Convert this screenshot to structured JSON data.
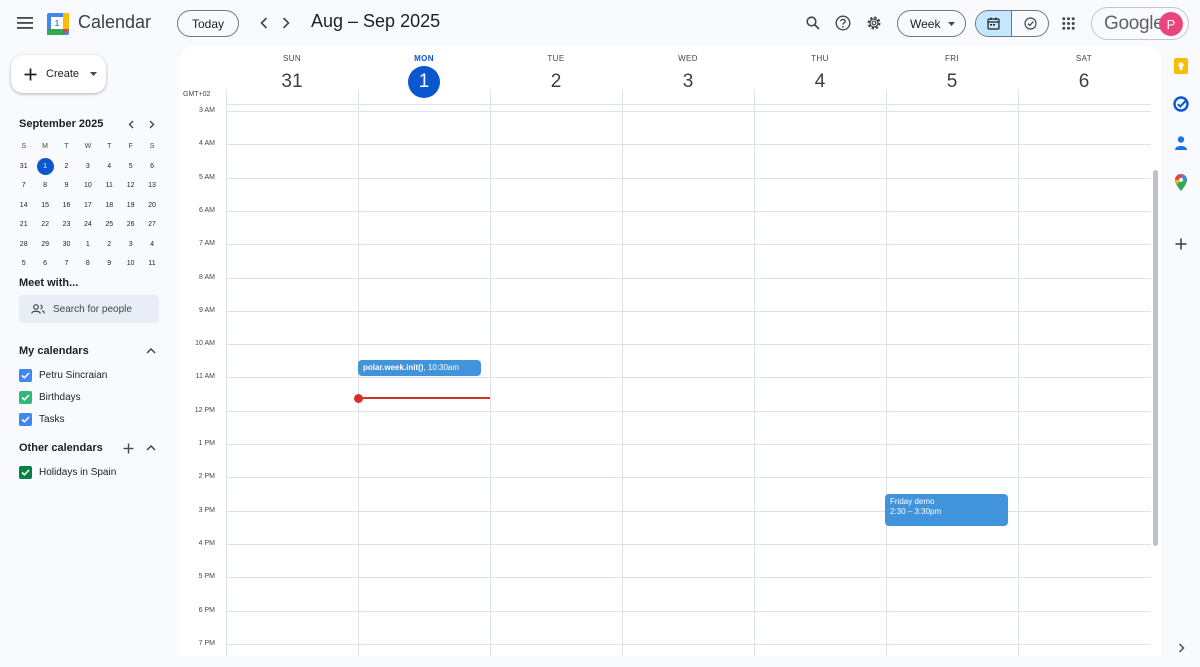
{
  "header": {
    "app_title": "Calendar",
    "logo_day": "1",
    "today_label": "Today",
    "date_range": "Aug – Sep 2025",
    "view_label": "Week",
    "google_label": "Google",
    "avatar_initial": "P"
  },
  "sidebar": {
    "create_label": "Create",
    "mini_calendar": {
      "title": "September 2025",
      "weekdays": [
        "S",
        "M",
        "T",
        "W",
        "T",
        "F",
        "S"
      ],
      "weeks": [
        [
          "31",
          "1",
          "2",
          "3",
          "4",
          "5",
          "6"
        ],
        [
          "7",
          "8",
          "9",
          "10",
          "11",
          "12",
          "13"
        ],
        [
          "14",
          "15",
          "16",
          "17",
          "18",
          "19",
          "20"
        ],
        [
          "21",
          "22",
          "23",
          "24",
          "25",
          "26",
          "27"
        ],
        [
          "28",
          "29",
          "30",
          "1",
          "2",
          "3",
          "4"
        ],
        [
          "5",
          "6",
          "7",
          "8",
          "9",
          "10",
          "11"
        ]
      ],
      "today_label": "1"
    },
    "meet_title": "Meet with...",
    "search_placeholder": "Search for people",
    "my_calendars_title": "My calendars",
    "my_calendars": [
      {
        "name": "Petru Sincraian",
        "color": "#4285f4"
      },
      {
        "name": "Birthdays",
        "color": "#33b679"
      },
      {
        "name": "Tasks",
        "color": "#4285f4"
      }
    ],
    "other_calendars_title": "Other calendars",
    "other_calendars": [
      {
        "name": "Holidays in Spain",
        "color": "#0b8043"
      }
    ]
  },
  "week": {
    "timezone": "GMT+02",
    "days": [
      {
        "dow": "SUN",
        "num": "31"
      },
      {
        "dow": "MON",
        "num": "1"
      },
      {
        "dow": "TUE",
        "num": "2"
      },
      {
        "dow": "WED",
        "num": "3"
      },
      {
        "dow": "THU",
        "num": "4"
      },
      {
        "dow": "FRI",
        "num": "5"
      },
      {
        "dow": "SAT",
        "num": "6"
      }
    ],
    "hours": [
      "3 AM",
      "4 AM",
      "5 AM",
      "6 AM",
      "7 AM",
      "8 AM",
      "9 AM",
      "10 AM",
      "11 AM",
      "12 PM",
      "1 PM",
      "2 PM",
      "3 PM",
      "4 PM",
      "5 PM",
      "6 PM",
      "7 PM"
    ],
    "events": [
      {
        "title": "polar.week.init()",
        "time": ", 10:30am"
      },
      {
        "title": "Friday demo",
        "time": "2:30 – 3:30pm"
      }
    ]
  },
  "colors": {
    "accent": "#0b57d0",
    "event": "#4193db",
    "now_line": "#d93025"
  }
}
